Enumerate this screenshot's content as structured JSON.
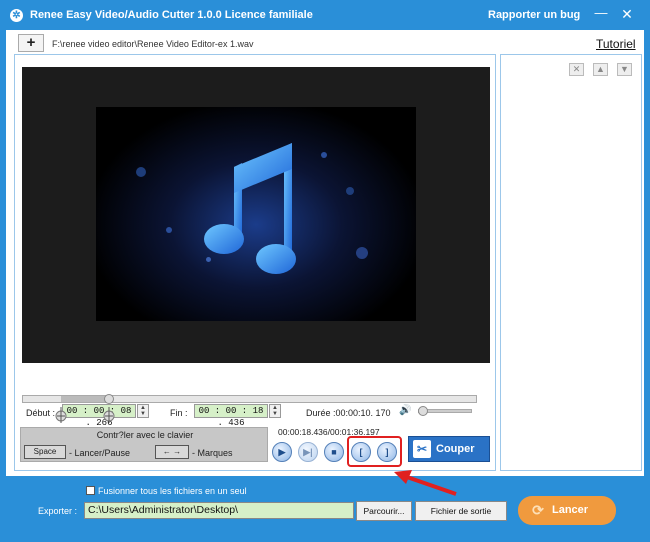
{
  "titlebar": {
    "title": "Renee Easy Video/Audio Cutter 1.0.0 Licence familiale",
    "bug_link": "Rapporter un bug",
    "minimize": "—",
    "close": "✕"
  },
  "toolbar": {
    "add_label": "+",
    "file_path": "F:\\renee video editor\\Renee Video Editor-ex 1.wav",
    "tutorial_label": "Tutoriel"
  },
  "times": {
    "debut_label": "Début :",
    "debut_value": "00 : 00 : 08 . 266",
    "fin_label": "Fin :",
    "fin_value": "00 : 00 : 18 . 436",
    "duree_label": "Durée :00:00:10. 170"
  },
  "keyboard": {
    "title": "Contr?ler avec le clavier",
    "space_key": "Space",
    "space_desc": "- Lancer/Pause",
    "arrow_key": "← →",
    "arrow_desc": "- Marques"
  },
  "playback": {
    "time": "00:00:18.436/00:01:36.197"
  },
  "actions": {
    "cut_label": "Couper"
  },
  "footer": {
    "merge_label": "Fusionner tous les fichiers en un seul",
    "export_label": "Exporter :",
    "export_path": "C:\\Users\\Administrator\\Desktop\\",
    "browse_label": "Parcourir...",
    "output_label": "Fichier de sortie",
    "launch_label": "Lancer"
  },
  "colors": {
    "window_blue": "#2a8fd8",
    "time_field_green": "#d6f0c8",
    "cut_button": "#2a72c6",
    "launch_button": "#f09a3e",
    "highlight_red": "#e02020"
  },
  "timeline": {
    "selection_start_fraction": 0.086,
    "selection_end_fraction": 0.192,
    "volume_fraction": 0.0
  }
}
